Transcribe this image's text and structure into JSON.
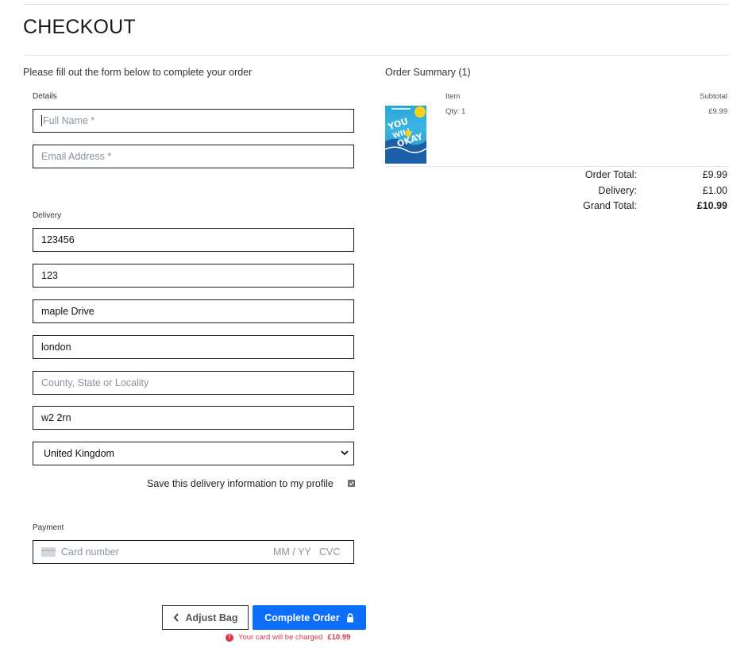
{
  "page": {
    "title": "CHECKOUT",
    "intro": "Please fill out the form below to complete your order"
  },
  "details": {
    "label": "Details",
    "full_name_placeholder": "Full Name *",
    "email_placeholder": "Email Address *"
  },
  "delivery": {
    "label": "Delivery",
    "phone": "123456",
    "street1": "123",
    "street2": "maple Drive",
    "town": "london",
    "county_placeholder": "County, State or Locality",
    "postcode": "w2 2rn",
    "country": "United Kingdom",
    "save_label": "Save this delivery information to my profile",
    "save_checked": true
  },
  "payment": {
    "label": "Payment",
    "card_placeholder": "Card number",
    "expiry_placeholder": "MM / YY",
    "cvc_placeholder": "CVC"
  },
  "actions": {
    "adjust_label": "Adjust Bag",
    "complete_label": "Complete Order",
    "charge_prefix": "Your card will be charged",
    "charge_amount": "£10.99"
  },
  "summary": {
    "title": "Order Summary (1)",
    "col_item": "Item",
    "col_subtotal": "Subtotal",
    "items": [
      {
        "qty": "Qty: 1",
        "subtotal": "£9.99",
        "cover_text": "YOU WILL BE OKAY"
      }
    ],
    "order_total_label": "Order Total:",
    "order_total": "£9.99",
    "delivery_label": "Delivery:",
    "delivery": "£1.00",
    "grand_total_label": "Grand Total:",
    "grand_total": "£10.99"
  },
  "colors": {
    "primary": "#0d6efd",
    "danger": "#dc3545",
    "placeholder": "#8a94a0"
  }
}
